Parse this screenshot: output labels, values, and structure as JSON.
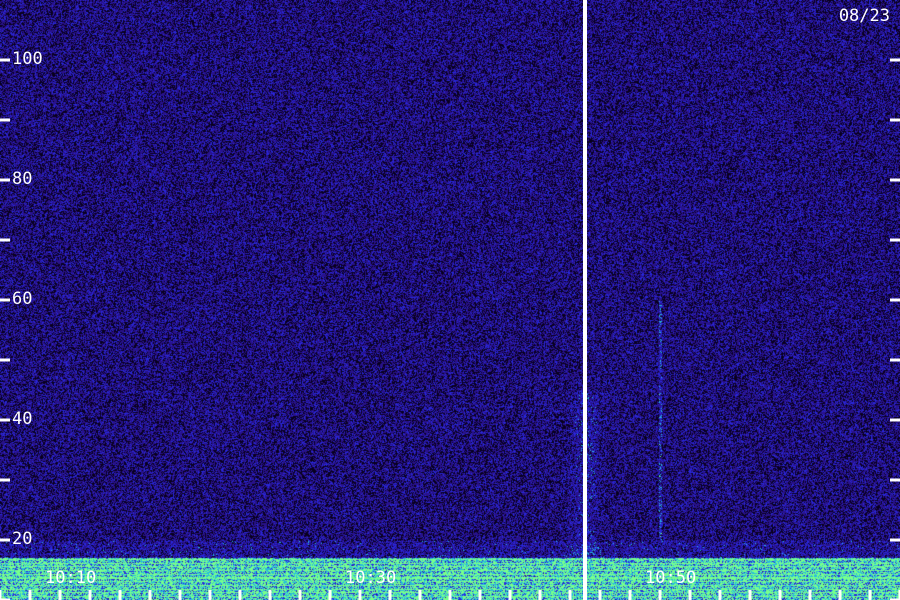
{
  "date_label": "08/23",
  "colors": {
    "background_low": "#20106a",
    "background_noise_dark": "#05001a",
    "energy_mid": "#2a2ae0",
    "energy_high": "#38c8c8",
    "energy_peak": "#7dff8a",
    "marker_line": "#ffffff",
    "tick": "#ffffff"
  },
  "chart_data": {
    "type": "heatmap",
    "title": "",
    "xlabel": "",
    "ylabel": "",
    "y_range": [
      10,
      110
    ],
    "y_ticks": [
      20,
      40,
      60,
      80,
      100
    ],
    "y_tick_labels": [
      "20",
      "40",
      "60",
      "80",
      "100"
    ],
    "x_range_minutes": [
      "10:05",
      "11:05"
    ],
    "x_tick_labels": [
      "10:10",
      "10:30",
      "10:50"
    ],
    "x_tick_positions": [
      "10:10",
      "10:30",
      "10:50"
    ],
    "marker_time": "10:44",
    "features": [
      {
        "type": "noise_floor",
        "level": 0.25
      },
      {
        "type": "low_frequency_band",
        "y_from": 10,
        "y_to": 17,
        "intensity": 0.85
      },
      {
        "type": "vertical_burst",
        "time": "10:44",
        "y_from": 17,
        "y_to": 45,
        "intensity": 0.55
      },
      {
        "type": "vertical_line",
        "time": "10:49",
        "y_from": 20,
        "y_to": 60,
        "intensity": 0.6
      }
    ]
  }
}
